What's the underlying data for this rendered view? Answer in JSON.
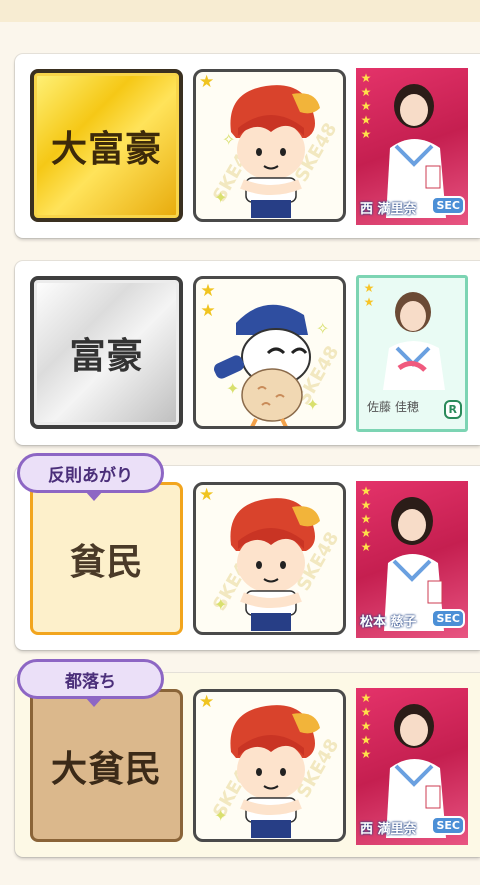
{
  "rows": [
    {
      "rank_label": "大富豪",
      "badge": "",
      "mascot": "ebi-boy",
      "mascot_stars": "★",
      "card_name": "西 満里奈",
      "card_rarity": "SEC",
      "card_stars": "★★★★★"
    },
    {
      "rank_label": "富豪",
      "badge": "",
      "mascot": "owl",
      "mascot_stars": "★★",
      "card_name": "佐藤 佳穂",
      "card_rarity": "R",
      "card_stars": "★★"
    },
    {
      "rank_label": "貧民",
      "badge": "反則あがり",
      "mascot": "ebi-boy",
      "mascot_stars": "★",
      "card_name": "松本 慈子",
      "card_rarity": "SEC",
      "card_stars": "★★★★★"
    },
    {
      "rank_label": "大貧民",
      "badge": "都落ち",
      "mascot": "ebi-boy",
      "mascot_stars": "★",
      "card_name": "西 満里奈",
      "card_rarity": "SEC",
      "card_stars": "★★★★★"
    }
  ],
  "colors": {
    "gold": "#f5c816",
    "silver": "#dcdcdc",
    "cream": "#fdf0cb",
    "tan": "#dbb88c",
    "badge_purple": "#8d66c4",
    "sec_red": "#e4336a",
    "r_green": "#7cd4b3"
  },
  "watermark": "SKE48"
}
